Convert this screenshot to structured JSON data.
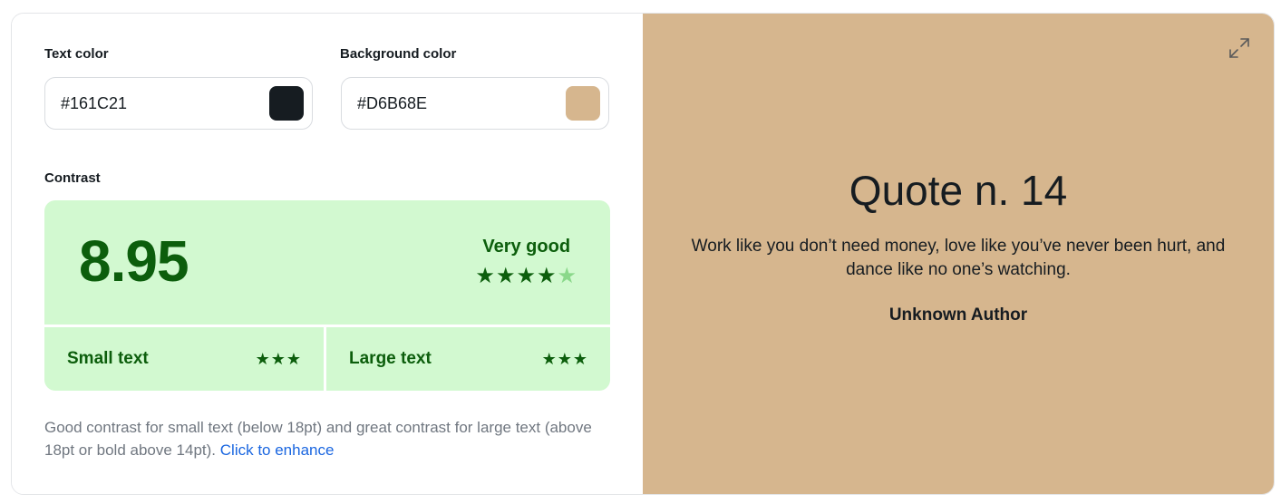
{
  "text_color": {
    "label": "Text color",
    "value": "#161C21",
    "swatch": "#161C21"
  },
  "background_color": {
    "label": "Background color",
    "value": "#D6B68E",
    "swatch": "#D6B68E"
  },
  "contrast": {
    "label": "Contrast",
    "ratio": "8.95",
    "rating_label": "Very good",
    "rating_stars": 4,
    "rating_max": 5,
    "small_text": {
      "label": "Small text",
      "stars": 3
    },
    "large_text": {
      "label": "Large text",
      "stars": 3
    }
  },
  "hint": {
    "text": "Good contrast for small text (below 18pt) and great contrast for large text (above 18pt or bold above 14pt).",
    "link": "Click to enhance"
  },
  "preview": {
    "title": "Quote n. 14",
    "quote": "Work like you don’t need money, love like you’ve never been hurt, and dance like no one’s watching.",
    "author": "Unknown Author",
    "expand_icon": "expand-arrows-icon"
  },
  "colors": {
    "accent_green": "#0c5e0c",
    "good_bg": "#d2f9d0",
    "link": "#1a66e0"
  }
}
